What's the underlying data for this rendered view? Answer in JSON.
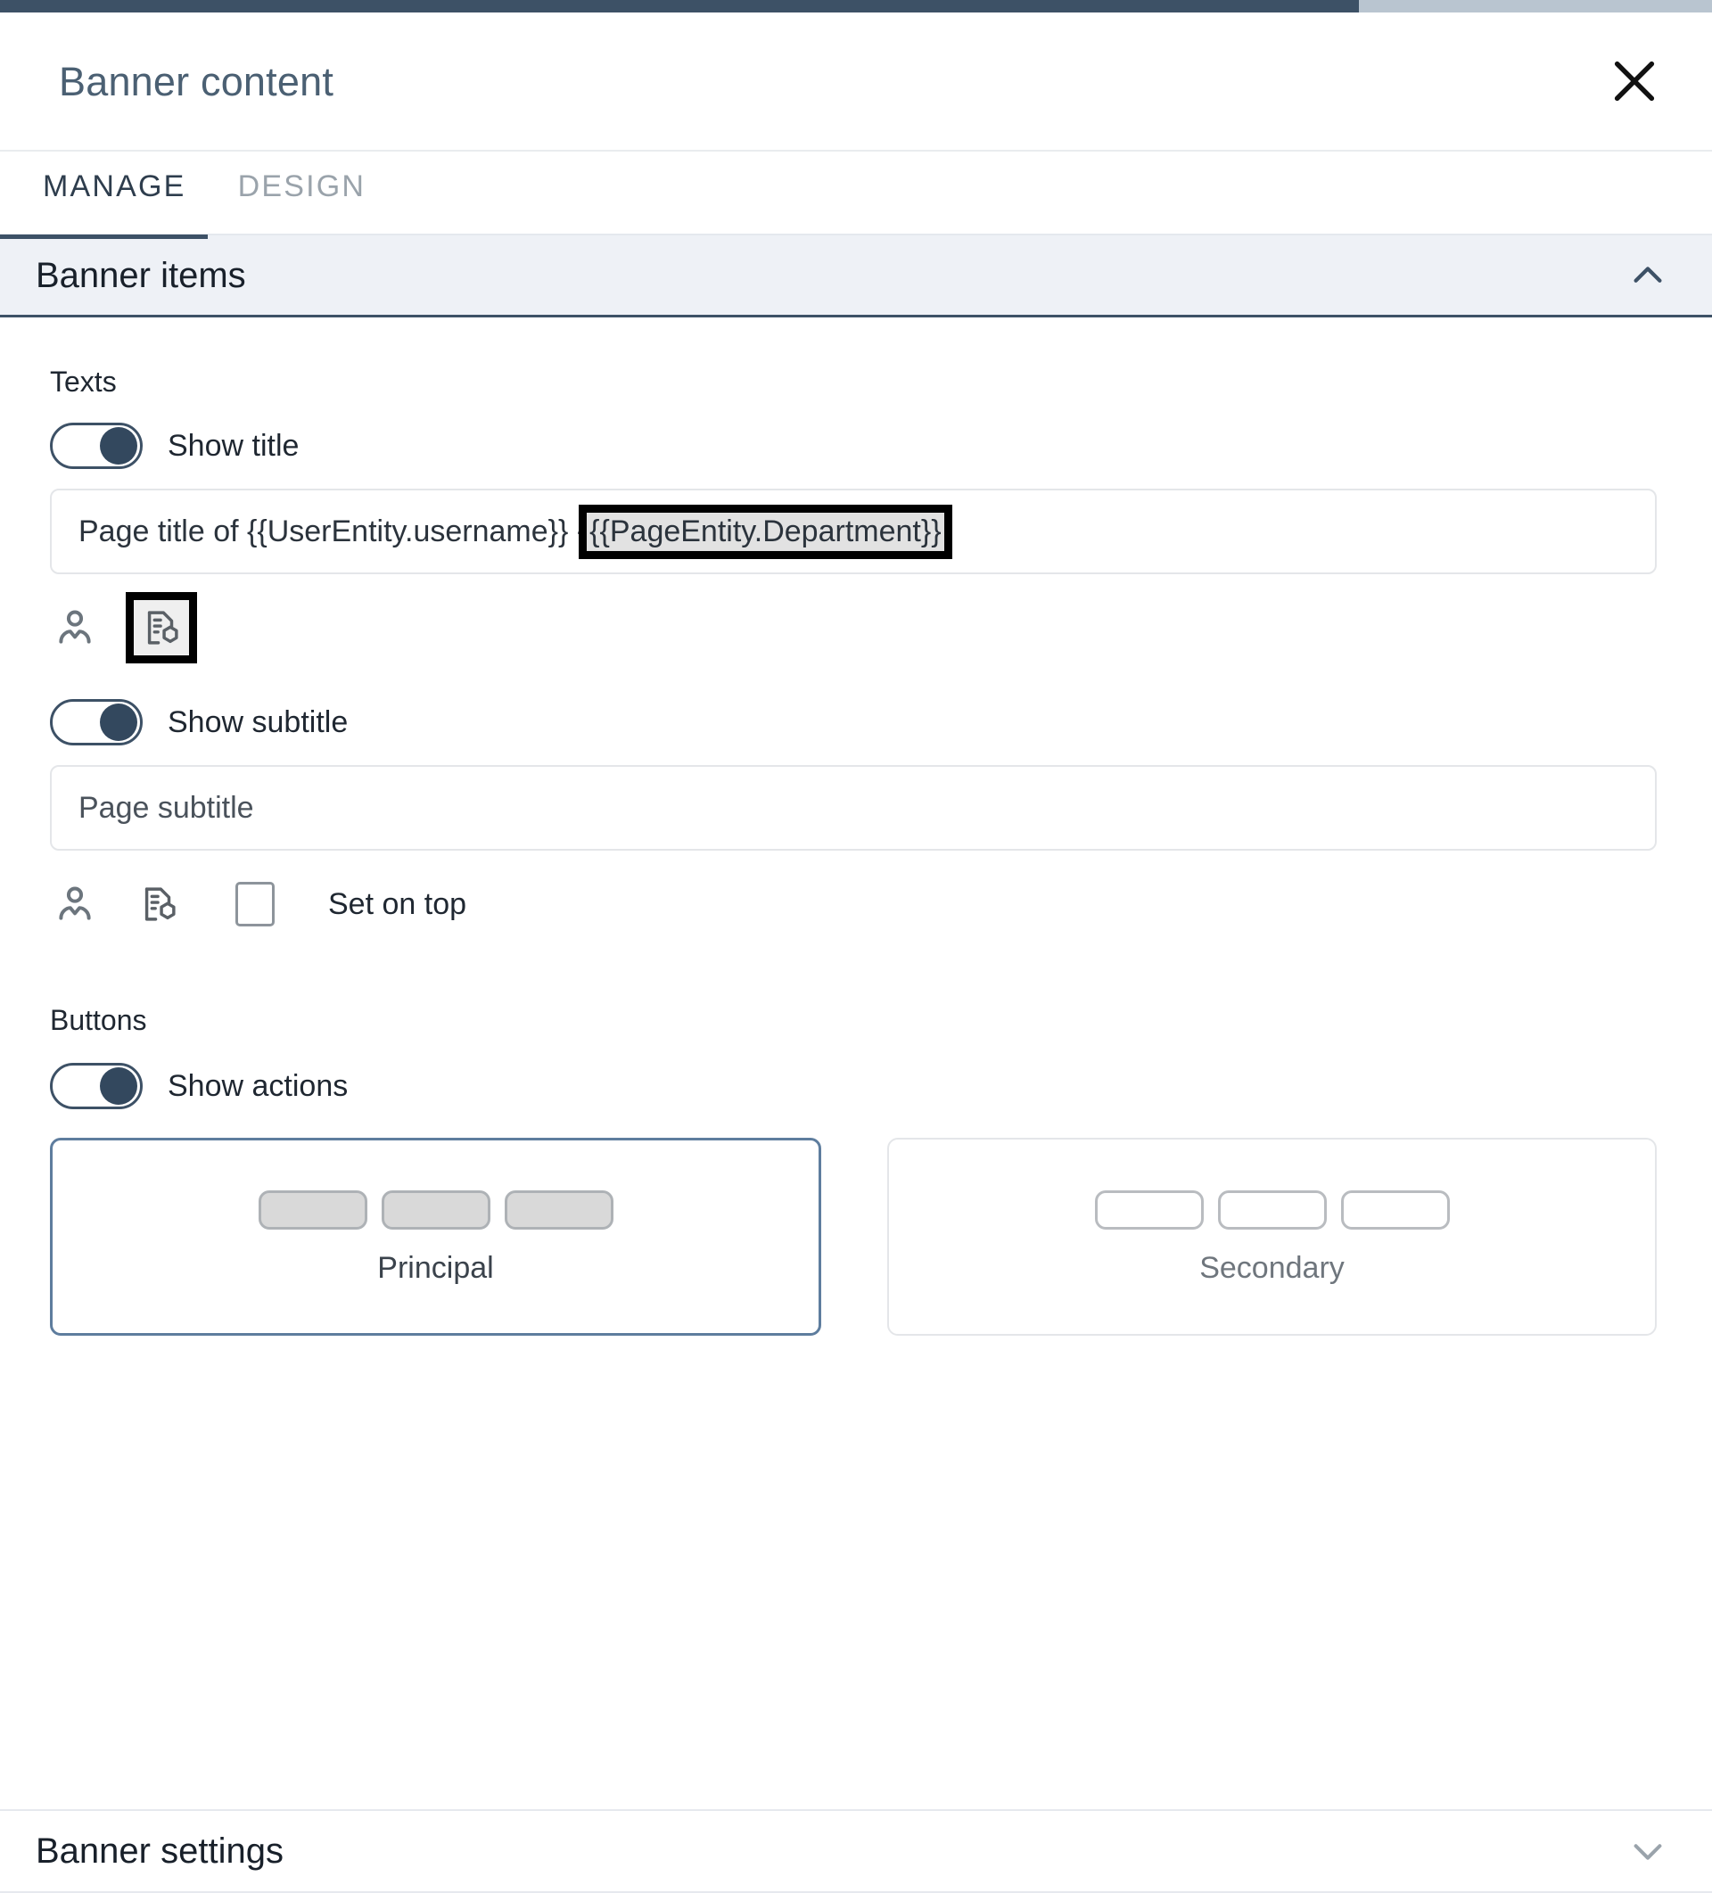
{
  "window": {
    "chrome_bar_color": "#3d5166",
    "chrome_bar_secondary_color": "#b9c5d0"
  },
  "header": {
    "title": "Banner content",
    "close_icon": "close-icon"
  },
  "tabs": [
    {
      "label": "MANAGE",
      "active": true
    },
    {
      "label": "DESIGN",
      "active": false
    }
  ],
  "sections": {
    "banner_items": {
      "title": "Banner items",
      "expanded": true,
      "chevron_icon": "chevron-up-icon"
    },
    "banner_settings": {
      "title": "Banner settings",
      "expanded": false,
      "chevron_icon": "chevron-down-icon"
    }
  },
  "texts_group": {
    "label": "Texts",
    "show_title": {
      "label": "Show title",
      "enabled": true
    },
    "title_input": {
      "value_prefix": "Page title of {{UserEntity.username}} - ",
      "value_highlighted": "{{PageEntity.Department}}",
      "placeholder": "Page title"
    },
    "title_icons": [
      {
        "name": "user-entity-icon",
        "highlighted": false
      },
      {
        "name": "page-entity-icon",
        "highlighted": true
      }
    ],
    "show_subtitle": {
      "label": "Show subtitle",
      "enabled": true
    },
    "subtitle_input": {
      "value": "Page subtitle",
      "placeholder": "Page subtitle"
    },
    "subtitle_icons": [
      {
        "name": "user-entity-icon",
        "highlighted": false
      },
      {
        "name": "page-entity-icon",
        "highlighted": false
      }
    ],
    "set_on_top": {
      "label": "Set on top",
      "checked": false
    }
  },
  "buttons_group": {
    "label": "Buttons",
    "show_actions": {
      "label": "Show actions",
      "enabled": true
    },
    "layout_cards": [
      {
        "label": "Principal",
        "selected": true,
        "pill_style": "filled",
        "pill_count": 3
      },
      {
        "label": "Secondary",
        "selected": false,
        "pill_style": "outline",
        "pill_count": 3
      }
    ]
  },
  "colors": {
    "accent_navy": "#3d5166",
    "toggle_knob": "#33485e",
    "section_shade": "#eef1f6",
    "selected_border": "#5e7d9e",
    "highlight_outline": "#000000",
    "highlight_fill": "#e2e2e2"
  }
}
